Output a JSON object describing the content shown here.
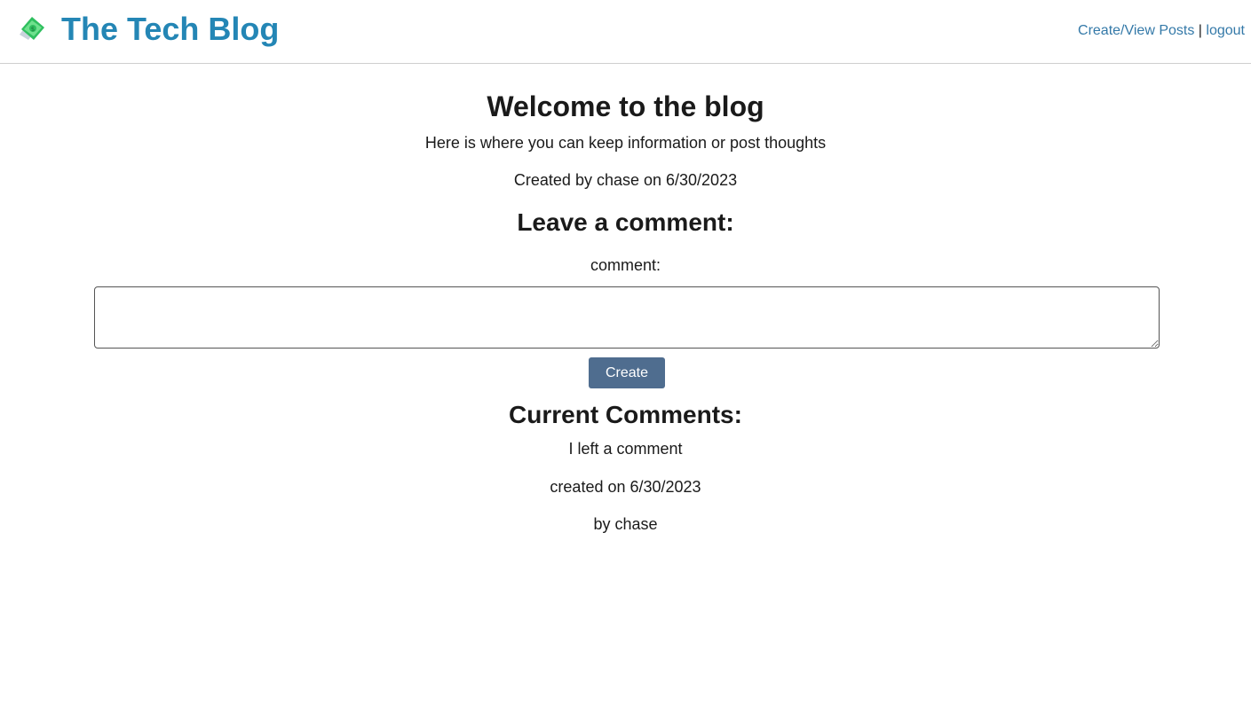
{
  "header": {
    "site_title": "The Tech Blog",
    "logo_icon": "money-with-wings-icon",
    "nav": {
      "create_view_posts": "Create/View Posts",
      "separator": "|",
      "logout": "logout"
    }
  },
  "post": {
    "title": "Welcome to the blog",
    "body": "Here is where you can keep information or post thoughts",
    "meta": "Created by chase on 6/30/2023"
  },
  "comment_form": {
    "heading": "Leave a comment:",
    "label": "comment:",
    "value": "",
    "submit_label": "Create"
  },
  "comments": {
    "heading": "Current Comments:",
    "items": [
      {
        "text": "I left a comment",
        "created": "created on 6/30/2023",
        "author": "by chase"
      }
    ]
  },
  "colors": {
    "brand": "#2486b5",
    "link": "#3479a8",
    "button": "#4f6d8f"
  }
}
